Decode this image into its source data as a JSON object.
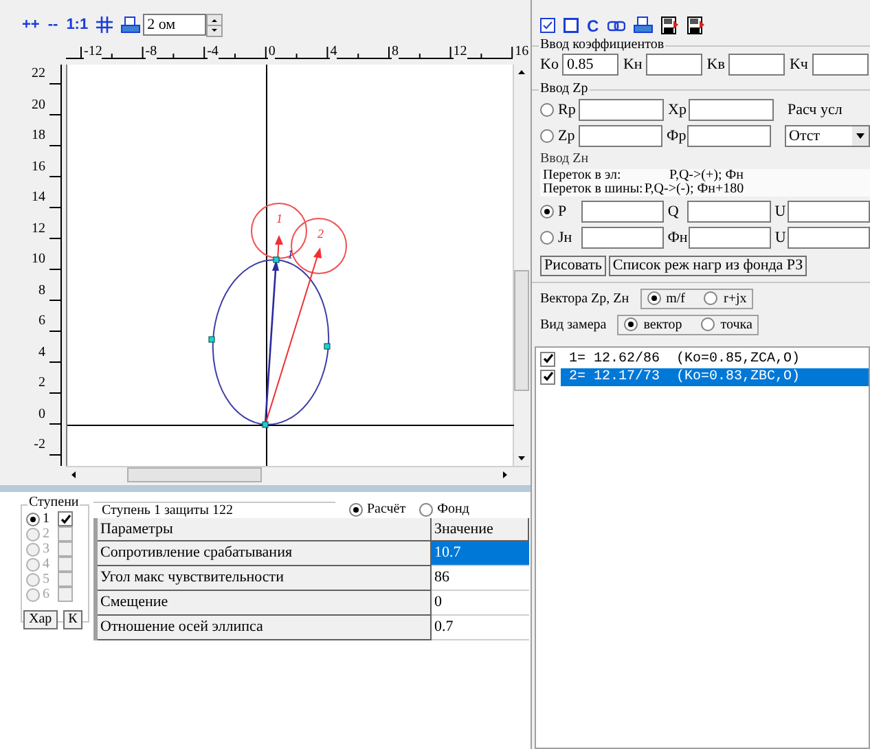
{
  "plot_toolbar": {
    "buttons": [
      "++",
      "--",
      "1:1"
    ],
    "scale_field": {
      "value": "2 ом"
    }
  },
  "x_ruler": [
    "-12",
    "-8",
    "-4",
    "0",
    "4",
    "8",
    "12",
    "16"
  ],
  "y_ruler": [
    "22",
    "20",
    "18",
    "16",
    "14",
    "12",
    "10",
    "8",
    "6",
    "4",
    "2",
    "0",
    "-2"
  ],
  "plot": {
    "vector_labels": [
      "1",
      "2"
    ],
    "point_label": "1"
  },
  "right_toolbar": {
    "letter_button": "C"
  },
  "coefficients": {
    "title": "Ввод коэффициентов",
    "fields": [
      {
        "label": "Ko",
        "value": "0.85"
      },
      {
        "label": "Kн"
      },
      {
        "label": "Kв"
      },
      {
        "label": "Kч"
      }
    ]
  },
  "zp": {
    "title": "Ввод  Zр",
    "rows": [
      {
        "radio": "Rр",
        "selected": false,
        "second": "Xр",
        "side_label": "Расч усл"
      },
      {
        "radio": "Zр",
        "selected": false,
        "second": "Фр",
        "select": "Отст"
      }
    ]
  },
  "zn": {
    "title": "Ввод  Zн",
    "notes": [
      {
        "label": "Переток в эл:",
        "value": "P,Q->(+); Фн"
      },
      {
        "label": "Переток в шины:",
        "value": "P,Q->(-); Фн+180"
      }
    ],
    "rows": [
      {
        "radio": "P",
        "selected": true,
        "second": "Q",
        "third": "U"
      },
      {
        "radio": "Jн",
        "selected": false,
        "second": "Фн",
        "third": "U"
      }
    ]
  },
  "actions": [
    "Рисовать",
    "Список реж нагр из фонда РЗ"
  ],
  "vectors": {
    "label": "Вектора Zр, Zн",
    "options": [
      {
        "label": "m/f",
        "selected": true
      },
      {
        "label": "r+jx",
        "selected": false
      }
    ]
  },
  "measure": {
    "label": "Вид замера",
    "options": [
      {
        "label": "вектор",
        "selected": true
      },
      {
        "label": "точка",
        "selected": false
      }
    ]
  },
  "measurements": [
    {
      "text": "1= 12.62/86  (Ko=0.85,ZCA,O)",
      "checked": true,
      "selected": false
    },
    {
      "text": "2= 12.17/73  (Ko=0.83,ZBC,O)",
      "checked": true,
      "selected": true
    }
  ],
  "steps": {
    "title": "Ступени",
    "items": [
      {
        "label": "1",
        "selected": true,
        "checked": true,
        "disabled": false
      },
      {
        "label": "2",
        "selected": false,
        "checked": false,
        "disabled": true
      },
      {
        "label": "3",
        "selected": false,
        "checked": false,
        "disabled": true
      },
      {
        "label": "4",
        "selected": false,
        "checked": false,
        "disabled": true
      },
      {
        "label": "5",
        "selected": false,
        "checked": false,
        "disabled": true
      },
      {
        "label": "6",
        "selected": false,
        "checked": false,
        "disabled": true
      }
    ],
    "buttons": [
      "Хар",
      "К"
    ]
  },
  "params": {
    "title": "Ступень 1  защиты 122",
    "source": [
      {
        "label": "Расчёт",
        "selected": true
      },
      {
        "label": "Фонд",
        "selected": false
      }
    ],
    "columns": [
      "Параметры",
      "Значение"
    ],
    "rows": [
      {
        "name": "Сопротивление срабатывания",
        "value": "10.7",
        "selected": true
      },
      {
        "name": "Угол макс чувствительности",
        "value": "86",
        "selected": false
      },
      {
        "name": "Смещение",
        "value": "0",
        "selected": false
      },
      {
        "name": "Отношение осей эллипса",
        "value": "0.7",
        "selected": false
      }
    ]
  }
}
